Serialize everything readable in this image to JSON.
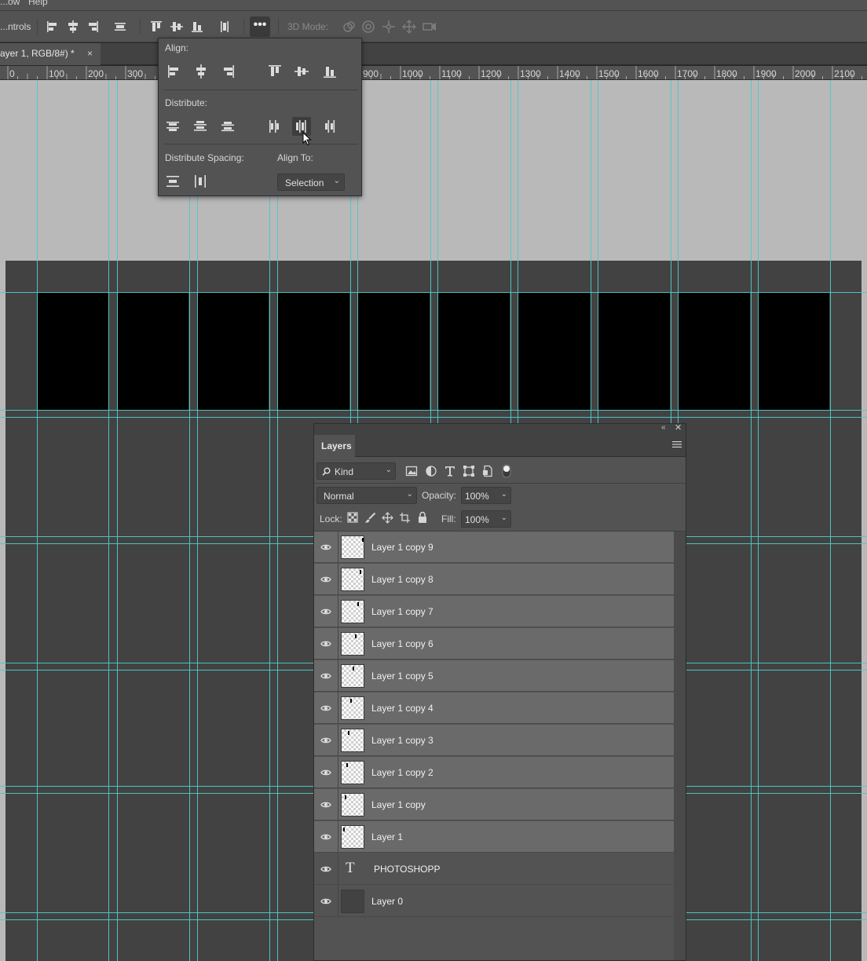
{
  "menubar": {
    "items": [
      "...ow",
      "Help"
    ]
  },
  "options": {
    "controls_label": "...ntrols",
    "more_label": "•••",
    "mode3d_label": "3D Mode:"
  },
  "document_tab": {
    "title": "ayer 1, RGB/8#) *",
    "close": "×"
  },
  "ruler": {
    "ticks": [
      "0",
      "100",
      "200",
      "300",
      "900",
      "1000",
      "1100",
      "1200",
      "1300",
      "1400",
      "1500",
      "1600",
      "1700",
      "1800",
      "1900",
      "2000",
      "2100"
    ]
  },
  "align_popup": {
    "align_label": "Align:",
    "distribute_label": "Distribute:",
    "distribute_spacing_label": "Distribute Spacing:",
    "align_to_label": "Align To:",
    "align_to_value": "Selection"
  },
  "layers_panel": {
    "title": "Layers",
    "filter_kind": "Kind",
    "blend_mode": "Normal",
    "opacity_label": "Opacity:",
    "opacity_value": "100%",
    "lock_label": "Lock:",
    "fill_label": "Fill:",
    "fill_value": "100%",
    "layers": [
      {
        "name": "Layer 1 copy 9",
        "type": "pixel",
        "selected": true
      },
      {
        "name": "Layer 1 copy 8",
        "type": "pixel",
        "selected": true
      },
      {
        "name": "Layer 1 copy 7",
        "type": "pixel",
        "selected": true
      },
      {
        "name": "Layer 1 copy 6",
        "type": "pixel",
        "selected": true
      },
      {
        "name": "Layer 1 copy 5",
        "type": "pixel",
        "selected": true
      },
      {
        "name": "Layer 1 copy 4",
        "type": "pixel",
        "selected": true
      },
      {
        "name": "Layer 1 copy 3",
        "type": "pixel",
        "selected": true
      },
      {
        "name": "Layer 1 copy 2",
        "type": "pixel",
        "selected": true
      },
      {
        "name": "Layer 1 copy",
        "type": "pixel",
        "selected": true
      },
      {
        "name": "Layer 1",
        "type": "pixel",
        "selected": true
      },
      {
        "name": "PHOTOSHOPP",
        "type": "text",
        "selected": false
      },
      {
        "name": "Layer 0",
        "type": "fill",
        "selected": false
      }
    ]
  },
  "colors": {
    "guide": "#4ec9c9",
    "panel": "#535353",
    "selected_row": "#6a6a6a",
    "pasteboard": "#b9b9b9",
    "artboard": "#424242"
  }
}
